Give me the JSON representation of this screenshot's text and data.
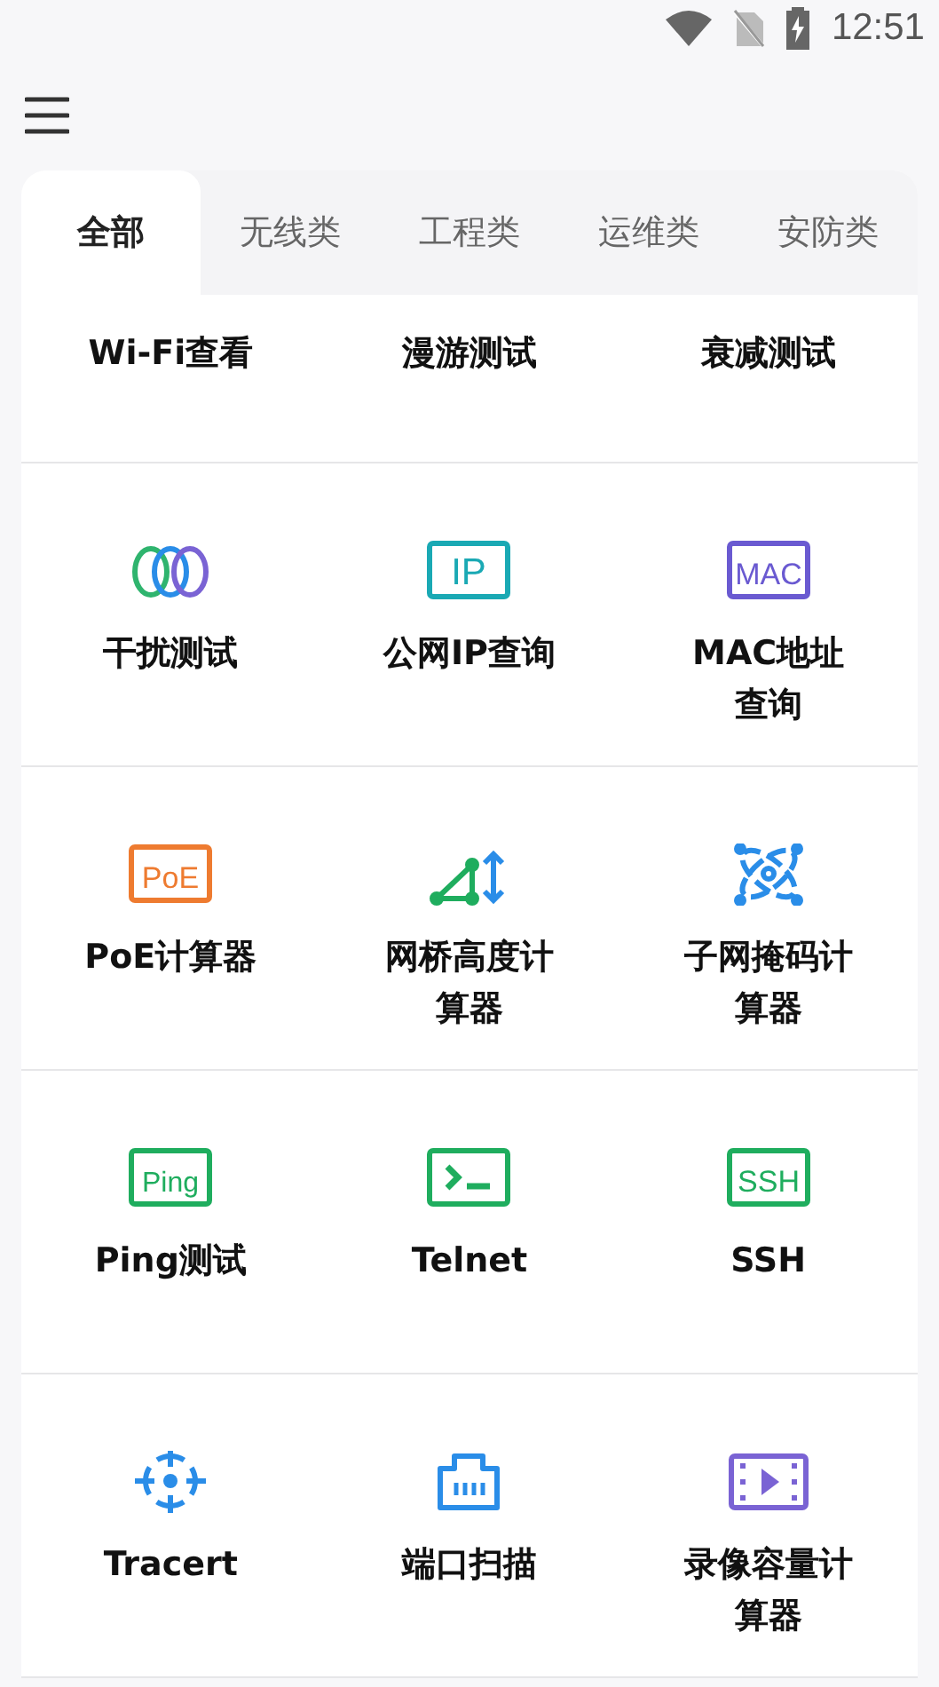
{
  "status_bar": {
    "time": "12:51"
  },
  "tabs": [
    {
      "label": "全部",
      "selected": true
    },
    {
      "label": "无线类",
      "selected": false
    },
    {
      "label": "工程类",
      "selected": false
    },
    {
      "label": "运维类",
      "selected": false
    },
    {
      "label": "安防类",
      "selected": false
    }
  ],
  "tools": [
    {
      "label": "Wi-Fi查看"
    },
    {
      "label": "漫游测试"
    },
    {
      "label": "衰减测试"
    },
    {
      "label": "干扰测试",
      "kind": "rings"
    },
    {
      "label": "公网IP查询",
      "kind": "badge",
      "badge": "IP",
      "color": "#1aa9b4"
    },
    {
      "label": "MAC地址查询",
      "kind": "badge",
      "badge": "MAC",
      "color": "#6a5ad1"
    },
    {
      "label": "PoE计算器",
      "kind": "badge",
      "badge": "PoE",
      "color": "#ee7b30"
    },
    {
      "label": "网桥高度计算器",
      "kind": "height"
    },
    {
      "label": "子网掩码计算器",
      "kind": "subnet"
    },
    {
      "label": "Ping测试",
      "kind": "badge",
      "badge": "Ping",
      "color": "#1fad5e"
    },
    {
      "label": "Telnet",
      "kind": "terminal"
    },
    {
      "label": "SSH",
      "kind": "badge",
      "badge": "SSH",
      "color": "#1fad5e"
    },
    {
      "label": "Tracert",
      "kind": "target"
    },
    {
      "label": "端口扫描",
      "kind": "port"
    },
    {
      "label": "录像容量计算器",
      "kind": "video"
    }
  ]
}
